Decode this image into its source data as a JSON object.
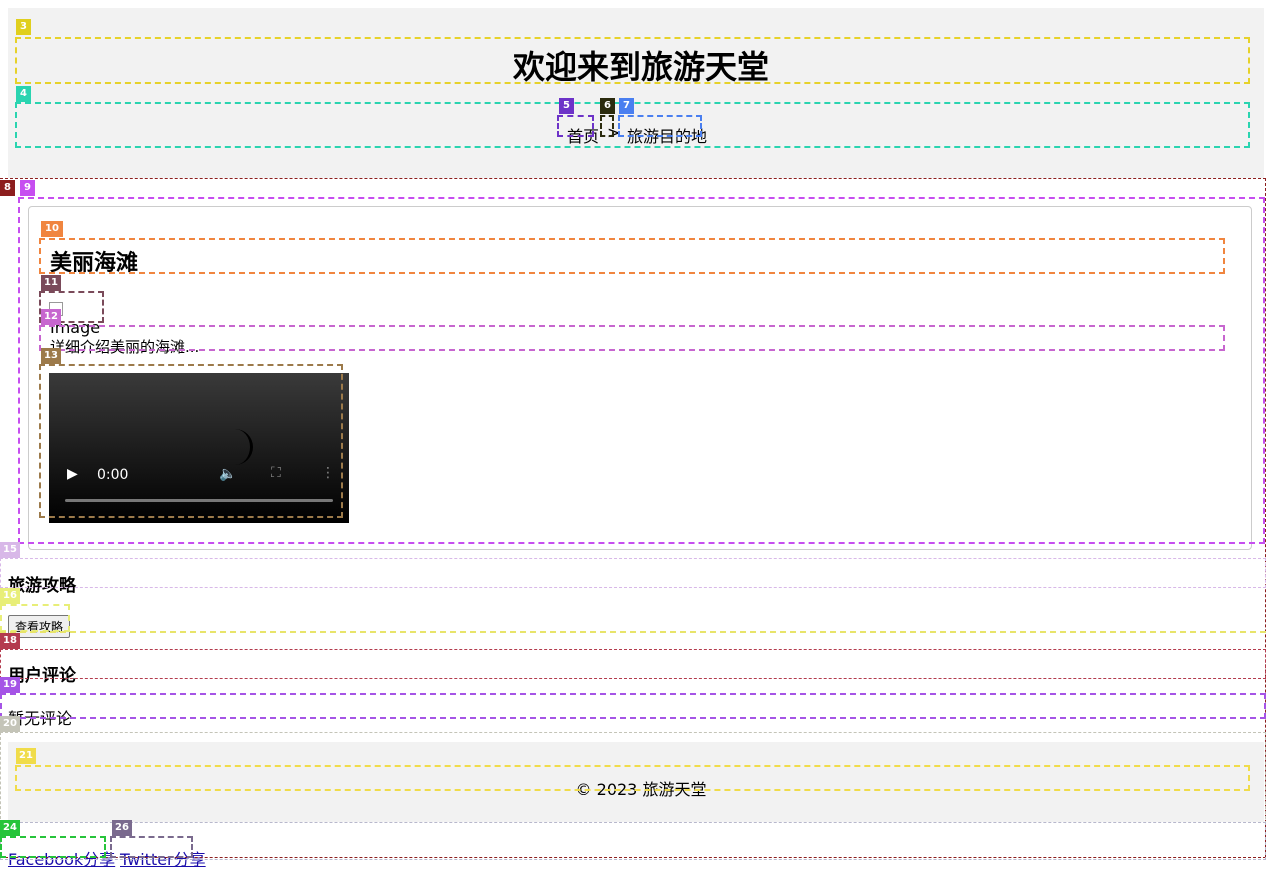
{
  "header": {
    "title": "欢迎来到旅游天堂",
    "breadcrumb": {
      "home": "首页",
      "separator": ">",
      "current": "旅游目的地"
    }
  },
  "article": {
    "title": "美丽海滩",
    "image_alt": "Image",
    "description": "详细介绍美丽的海滩...",
    "video": {
      "time": "0:00",
      "progress": 0
    }
  },
  "guide": {
    "title": "旅游攻略",
    "button_label": "查看攻略"
  },
  "comments": {
    "title": "用户评论",
    "empty_text": "暂无评论"
  },
  "footer": {
    "copyright": "© 2023 旅游天堂"
  },
  "share": {
    "facebook": "Facebook分享",
    "twitter": "Twitter分享"
  },
  "overlay_badges": [
    "3",
    "4",
    "5",
    "6",
    "7",
    "8",
    "9",
    "10",
    "11",
    "12",
    "13",
    "15",
    "16",
    "18",
    "19",
    "20",
    "21",
    "24",
    "26"
  ],
  "colors": {
    "band_bg": "#f2f2f2",
    "link": "#1a0dab"
  }
}
